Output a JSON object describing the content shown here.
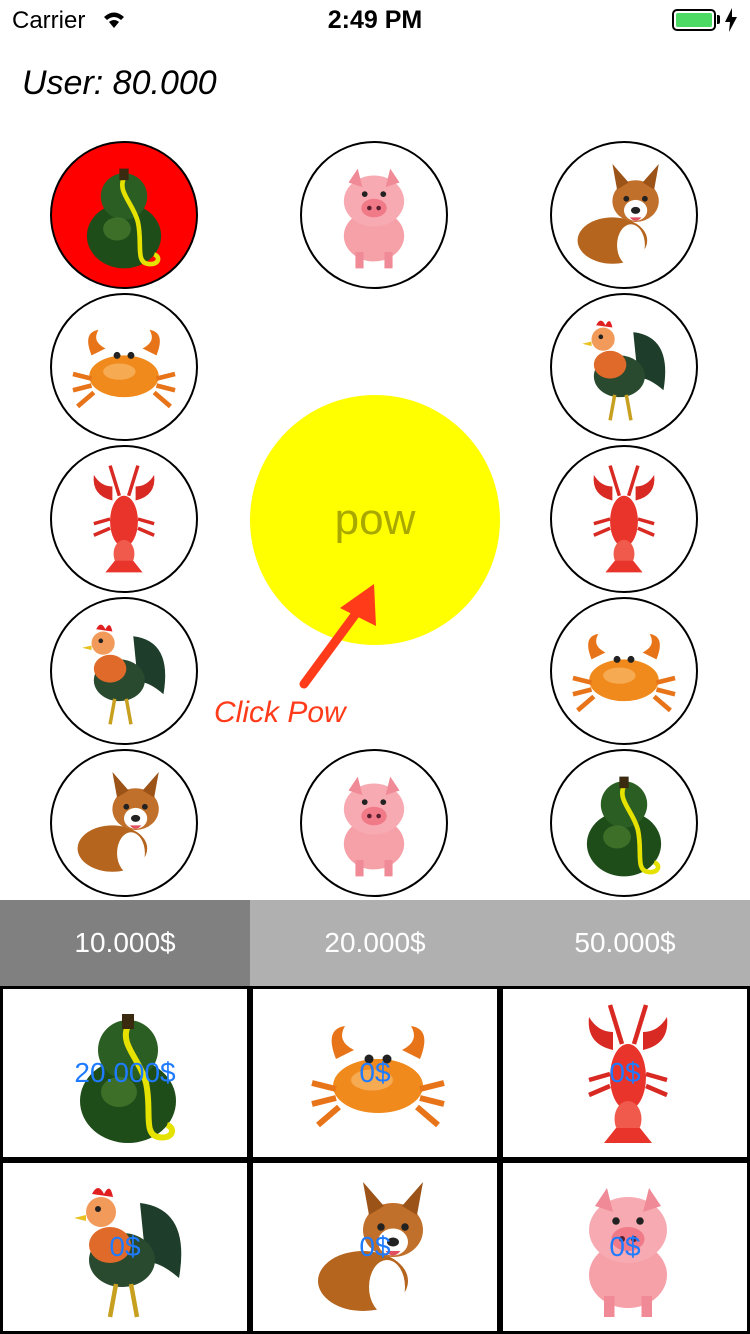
{
  "status_bar": {
    "carrier": "Carrier",
    "time": "2:49 PM",
    "battery_percent": 100
  },
  "user": {
    "label": "User: 80.000"
  },
  "board": {
    "tokens": [
      {
        "animal": "gourd",
        "active": true
      },
      {
        "animal": "pig",
        "active": false
      },
      {
        "animal": "corgi",
        "active": false
      },
      {
        "animal": "crab",
        "active": false
      },
      {
        "animal": "rooster",
        "active": false
      },
      {
        "animal": "lobster",
        "active": false
      },
      {
        "animal": "lobster",
        "active": false
      },
      {
        "animal": "rooster",
        "active": false
      },
      {
        "animal": "crab",
        "active": false
      },
      {
        "animal": "corgi",
        "active": false
      },
      {
        "animal": "pig",
        "active": false
      },
      {
        "animal": "gourd",
        "active": false
      }
    ],
    "pow_label": "pow",
    "hint": "Click Pow"
  },
  "bets": {
    "options": [
      "10.000$",
      "20.000$",
      "50.000$"
    ],
    "selected_index": 0
  },
  "grid": {
    "cells": [
      {
        "animal": "gourd",
        "amount": "20.000$"
      },
      {
        "animal": "crab",
        "amount": "0$"
      },
      {
        "animal": "lobster",
        "amount": "0$"
      },
      {
        "animal": "rooster",
        "amount": "0$"
      },
      {
        "animal": "corgi",
        "amount": "0$"
      },
      {
        "animal": "pig",
        "amount": "0$"
      }
    ]
  },
  "colors": {
    "active_token": "#ff0000",
    "pow": "#ffff00",
    "hint": "#ff3b1a",
    "amount_text": "#1f7bff",
    "bet_selected": "#808080",
    "bet_bar": "#b0b0b0"
  }
}
